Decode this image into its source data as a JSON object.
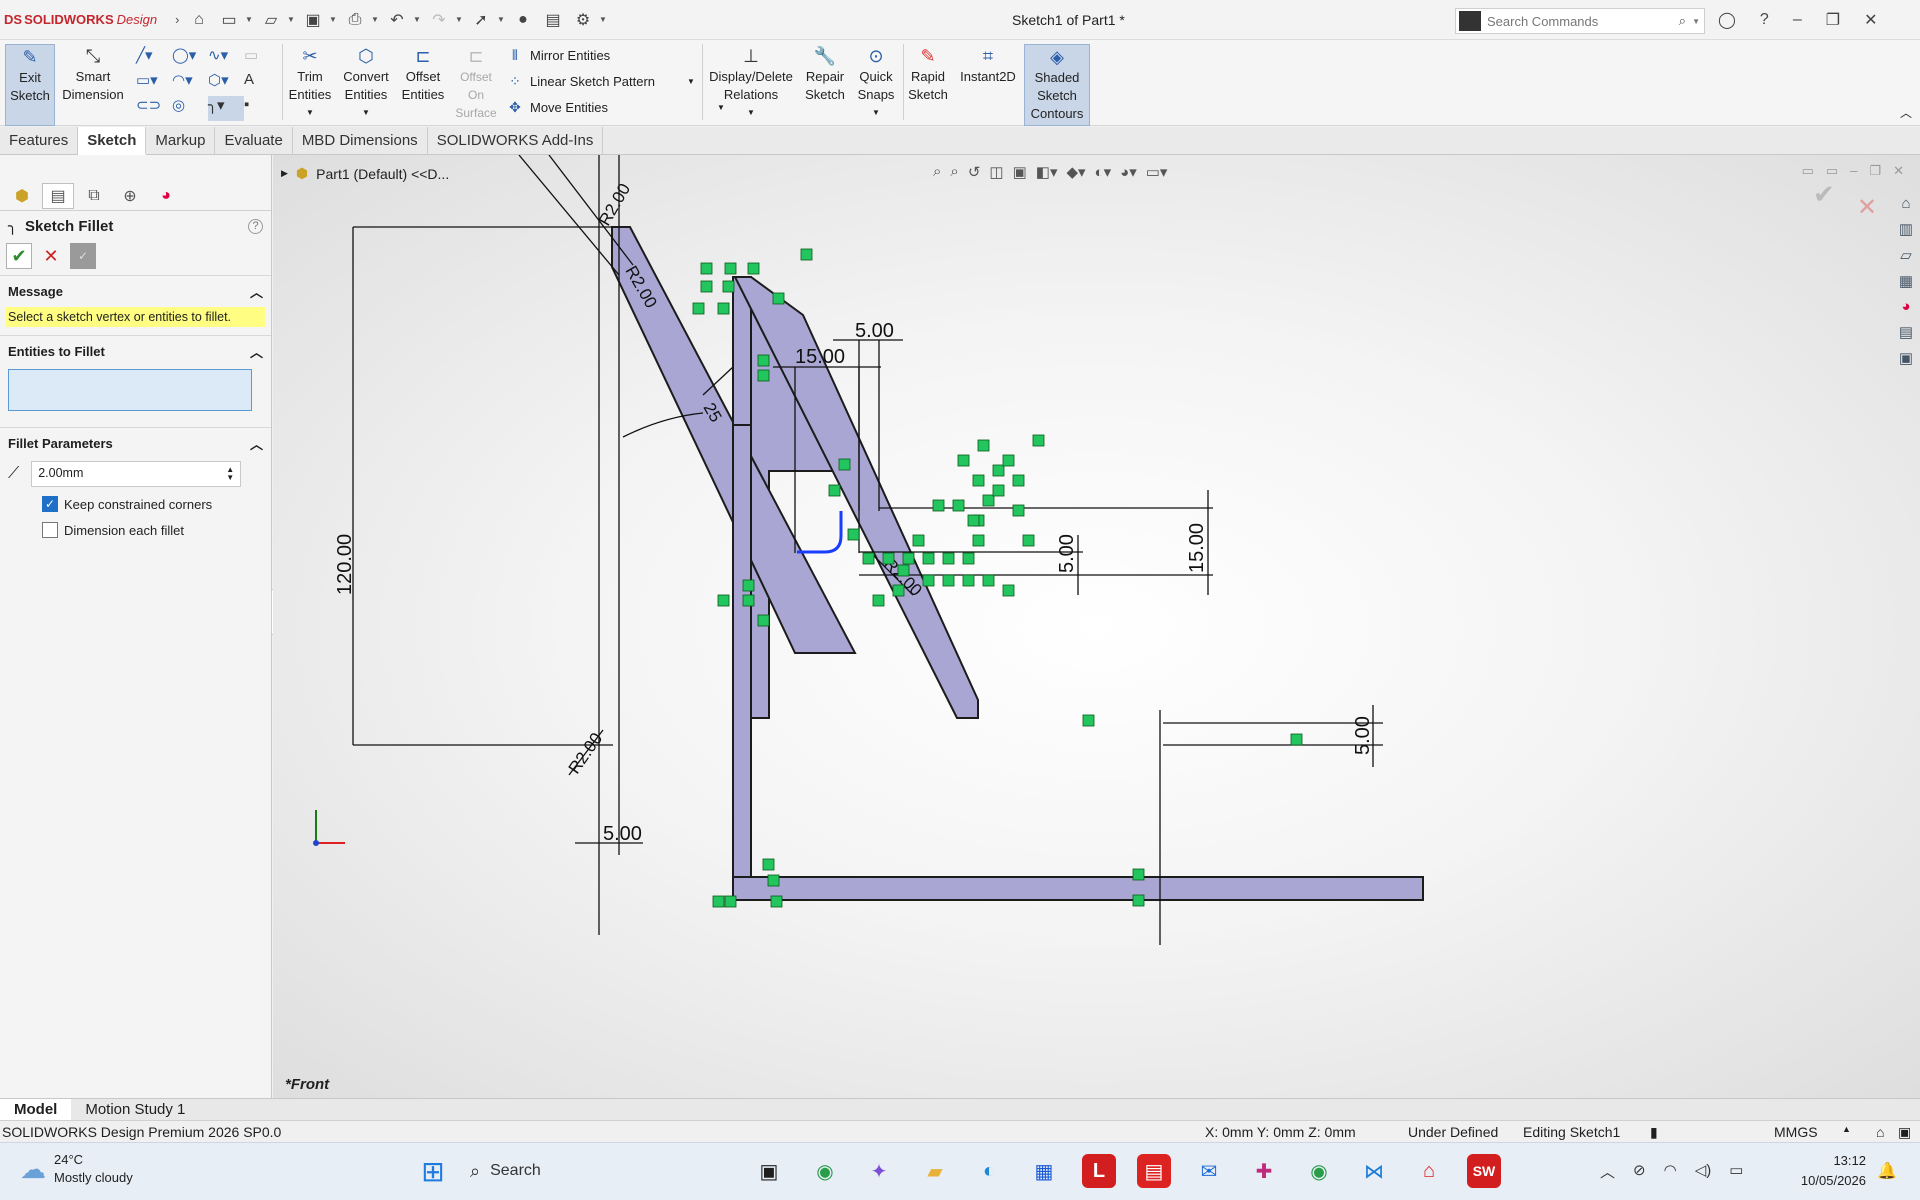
{
  "app": {
    "brand_prefix": "DS",
    "brand_name": "SOLIDWORKS",
    "brand_suffix": "Design",
    "doc_title": "Sketch1 of Part1 *"
  },
  "search": {
    "placeholder": "Search Commands"
  },
  "ribbon": {
    "exit_sketch": "Exit\nSketch",
    "smart_dimension": "Smart\nDimension",
    "trim": "Trim\nEntities",
    "convert": "Convert\nEntities",
    "offset": "Offset\nEntities",
    "offset_surface": "Offset\nOn\nSurface",
    "mirror": "Mirror Entities",
    "linear_pattern": "Linear Sketch Pattern",
    "move": "Move Entities",
    "display_delete": "Display/Delete\nRelations",
    "repair": "Repair\nSketch",
    "quick_snaps": "Quick\nSnaps",
    "rapid": "Rapid\nSketch",
    "instant2d": "Instant2D",
    "shaded": "Shaded\nSketch\nContours"
  },
  "tabs": [
    "Features",
    "Sketch",
    "Markup",
    "Evaluate",
    "MBD Dimensions",
    "SOLIDWORKS Add-Ins"
  ],
  "panel": {
    "title": "Sketch Fillet",
    "message_header": "Message",
    "message": "Select a sketch vertex or entities to fillet.",
    "entities_header": "Entities to Fillet",
    "params_header": "Fillet Parameters",
    "radius_value": "2.00mm",
    "keep_corners": "Keep constrained corners",
    "dimension_each": "Dimension each fillet"
  },
  "canvas": {
    "tree_label": "Part1 (Default) <<D...",
    "view_label": "*Front",
    "dims": {
      "d120": "120.00",
      "d5_bottom": "5.00",
      "d15_top": "15.00",
      "d5_top": "5.00",
      "d5_right": "5.00",
      "d15_right": "15.00",
      "d5_far": "5.00",
      "r2_top": "R2.00",
      "r2_bottom": "R2.00",
      "r2_mid": "R2.00",
      "r200": "R2.00",
      "angle": "25"
    }
  },
  "bottom_tabs": [
    "Model",
    "Motion Study 1"
  ],
  "status": {
    "version": "SOLIDWORKS Design Premium 2026 SP0.0",
    "coords": "X: 0mm Y: 0mm Z: 0mm",
    "defined": "Under Defined",
    "editing": "Editing Sketch1",
    "units": "MMGS"
  },
  "taskbar": {
    "temp": "24°C",
    "weather": "Mostly cloudy",
    "search": "Search",
    "time": "13:12",
    "date": "10/05/2026"
  }
}
